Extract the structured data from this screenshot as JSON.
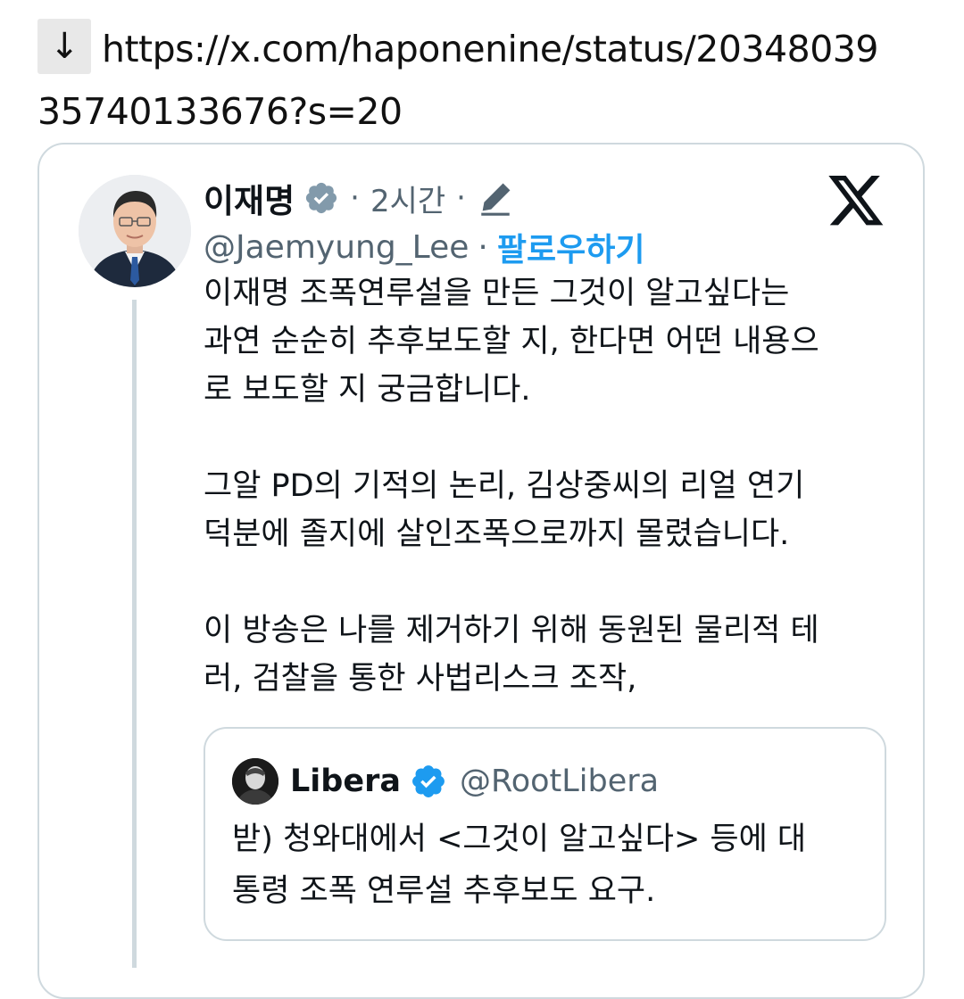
{
  "link": {
    "arrow": "↓",
    "url_line1": "https://x.com/haponenine/status/20348039",
    "url_line2": "35740133676?s=20"
  },
  "tweet": {
    "display_name": "이재명",
    "verified_badge_icon": "gray-verified-badge-icon",
    "separator": "·",
    "time": "2시간",
    "edit_icon": "pencil-icon",
    "handle": "@Jaemyung_Lee",
    "follow_label": "팔로우하기",
    "platform_logo": "x-logo-icon",
    "paragraphs": [
      "이재명 조폭연루설을 만든 그것이 알고싶다는",
      "과연 순순히 추후보도할 지, 한다면 어떤 내용으",
      "로 보도할 지 궁금합니다.",
      "그알 PD의 기적의 논리, 김상중씨의 리얼 연기",
      "덕분에 졸지에 살인조폭으로까지 몰렸습니다.",
      "이 방송은 나를 제거하기 위해 동원된 물리적 테",
      "러, 검찰을 통한 사법리스크 조작,"
    ]
  },
  "quote": {
    "display_name": "Libera",
    "verified_badge_icon": "blue-verified-badge-icon",
    "handle": "@RootLibera",
    "lines": [
      "받) 청와대에서 <그것이 알고싶다> 등에 대",
      "통령 조폭 연루설 추후보도 요구."
    ]
  },
  "colors": {
    "link_blue": "#1d9bf0",
    "secondary_text": "#536471",
    "border": "#cfd9de",
    "gray_badge": "#829aab",
    "blue_badge": "#1d9bf0"
  }
}
